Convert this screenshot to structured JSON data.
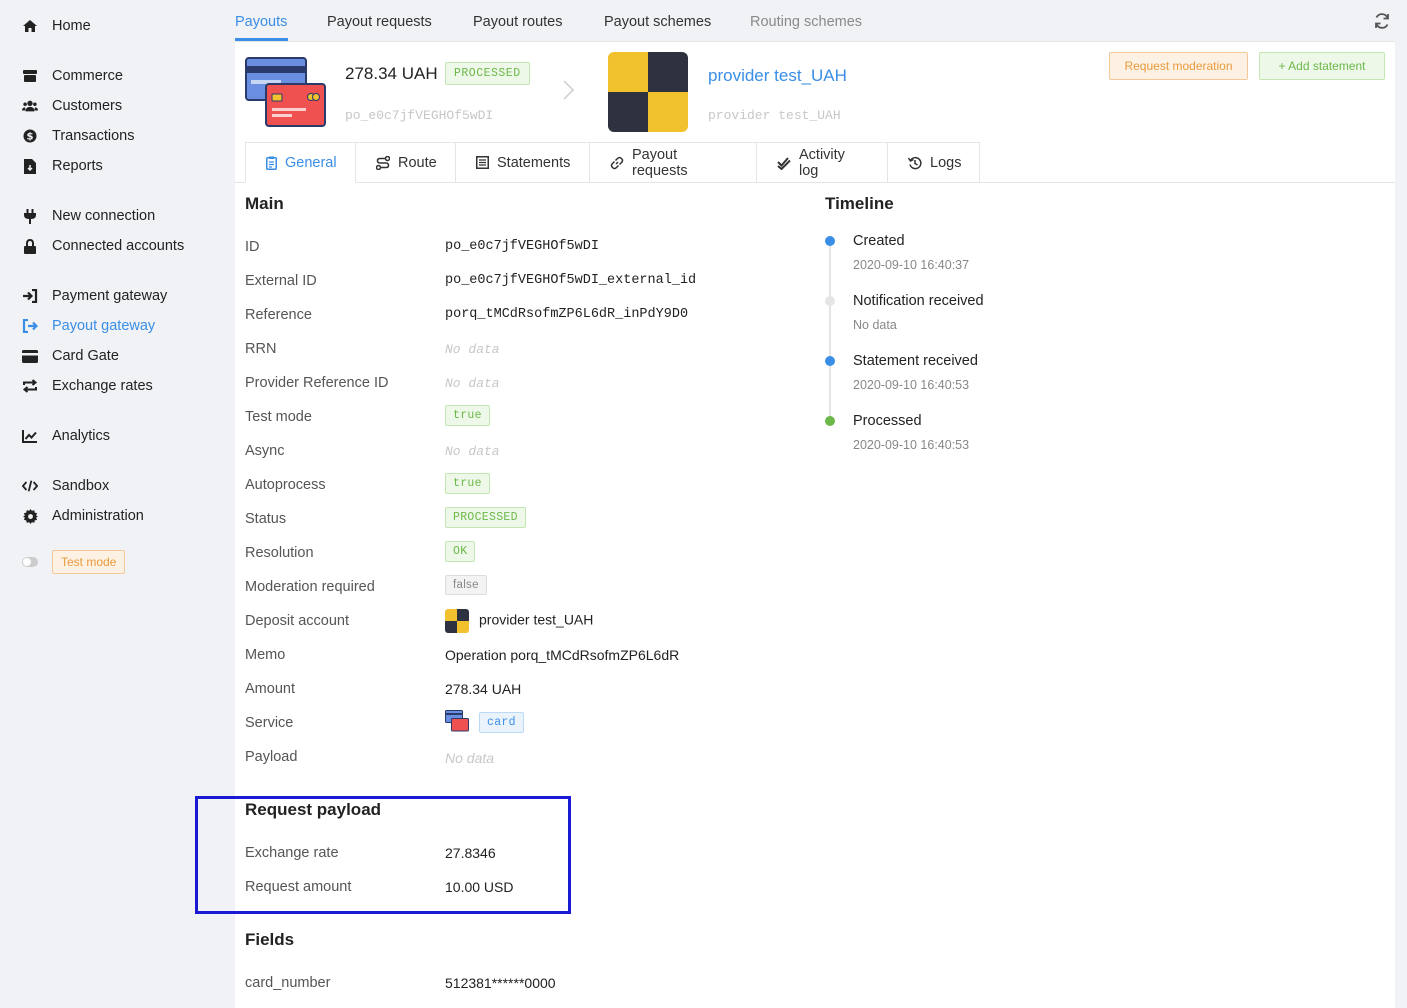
{
  "sidebar": {
    "items": [
      {
        "label": "Home",
        "icon": "home-icon"
      },
      {
        "label": "Commerce",
        "icon": "commerce-icon"
      },
      {
        "label": "Customers",
        "icon": "customers-icon"
      },
      {
        "label": "Transactions",
        "icon": "dollar-icon"
      },
      {
        "label": "Reports",
        "icon": "report-icon"
      },
      {
        "label": "New connection",
        "icon": "plug-icon"
      },
      {
        "label": "Connected accounts",
        "icon": "lock-icon"
      },
      {
        "label": "Payment gateway",
        "icon": "sign-in-icon"
      },
      {
        "label": "Payout gateway",
        "icon": "sign-out-icon"
      },
      {
        "label": "Card Gate",
        "icon": "card-icon"
      },
      {
        "label": "Exchange rates",
        "icon": "exchange-icon"
      },
      {
        "label": "Analytics",
        "icon": "chart-line-icon"
      },
      {
        "label": "Sandbox",
        "icon": "code-icon"
      },
      {
        "label": "Administration",
        "icon": "cog-icon"
      }
    ],
    "active": "Payout gateway",
    "test_mode_label": "Test mode"
  },
  "top_tabs": [
    "Payouts",
    "Payout requests",
    "Payout routes",
    "Payout schemes",
    "Routing schemes"
  ],
  "header": {
    "amount": "278.34 UAH",
    "status": "PROCESSED",
    "payout_id": "po_e0c7jfVEGHOf5wDI",
    "provider_name": "provider test_UAH",
    "provider_sub": "provider test_UAH",
    "request_moderation": "Request moderation",
    "add_statement": "Add statement"
  },
  "sub_tabs": [
    "General",
    "Route",
    "Statements",
    "Payout requests",
    "Activity log",
    "Logs"
  ],
  "main": {
    "title": "Main",
    "rows": {
      "id": {
        "label": "ID",
        "value": "po_e0c7jfVEGHOf5wDI"
      },
      "external_id": {
        "label": "External ID",
        "value": "po_e0c7jfVEGHOf5wDI_external_id"
      },
      "reference": {
        "label": "Reference",
        "value": "porq_tMCdRsofmZP6L6dR_inPdY9D0"
      },
      "rrn": {
        "label": "RRN",
        "value": "No data"
      },
      "provider_ref": {
        "label": "Provider Reference ID",
        "value": "No data"
      },
      "test_mode": {
        "label": "Test mode",
        "value": "true"
      },
      "async": {
        "label": "Async",
        "value": "No data"
      },
      "autoprocess": {
        "label": "Autoprocess",
        "value": "true"
      },
      "status": {
        "label": "Status",
        "value": "PROCESSED"
      },
      "resolution": {
        "label": "Resolution",
        "value": "OK"
      },
      "moderation": {
        "label": "Moderation required",
        "value": "false"
      },
      "deposit": {
        "label": "Deposit account",
        "value": "provider test_UAH"
      },
      "memo": {
        "label": "Memo",
        "value": "Operation porq_tMCdRsofmZP6L6dR"
      },
      "amount": {
        "label": "Amount",
        "value": "278.34 UAH"
      },
      "service": {
        "label": "Service",
        "value": "card"
      },
      "payload": {
        "label": "Payload",
        "value": "No data"
      }
    }
  },
  "request_payload": {
    "title": "Request payload",
    "exchange_rate": {
      "label": "Exchange rate",
      "value": "27.8346"
    },
    "request_amount": {
      "label": "Request amount",
      "value": "10.00 USD"
    }
  },
  "fields": {
    "title": "Fields",
    "card_number": {
      "label": "card_number",
      "value": "512381******0000"
    }
  },
  "timeline": {
    "title": "Timeline",
    "events": [
      {
        "title": "Created",
        "time": "2020-09-10 16:40:37",
        "color": "#3a8ee6"
      },
      {
        "title": "Notification received",
        "time": "No data",
        "color": "#e5e5e5"
      },
      {
        "title": "Statement received",
        "time": "2020-09-10 16:40:53",
        "color": "#3a8ee6"
      },
      {
        "title": "Processed",
        "time": "2020-09-10 16:40:53",
        "color": "#6cb84a"
      }
    ]
  },
  "colors": {
    "accent": "#3a8ee6",
    "success": "#6cb84a",
    "warning": "#e89a3c",
    "highlight": "#1a1ad4"
  }
}
